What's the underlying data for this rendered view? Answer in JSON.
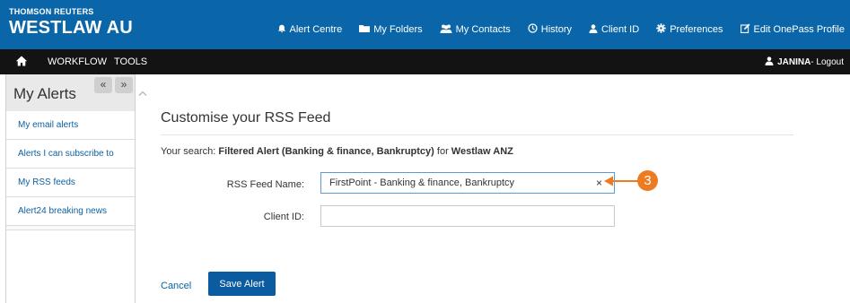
{
  "brand": {
    "company": "THOMSON REUTERS",
    "product": "WESTLAW AU"
  },
  "topnav": [
    {
      "label": "Alert Centre",
      "icon": "bell-icon"
    },
    {
      "label": "My Folders",
      "icon": "folder-icon"
    },
    {
      "label": "My Contacts",
      "icon": "contacts-icon"
    },
    {
      "label": "History",
      "icon": "clock-icon"
    },
    {
      "label": "Client ID",
      "icon": "user-icon"
    },
    {
      "label": "Preferences",
      "icon": "gear-icon"
    },
    {
      "label": "Edit OnePass Profile",
      "icon": "edit-icon"
    }
  ],
  "menubar": {
    "home_icon": "home-icon",
    "items": [
      "WORKFLOW",
      "TOOLS"
    ],
    "user_name": "JANINA",
    "logout": " - Logout"
  },
  "sidebar": {
    "title": "My Alerts",
    "collapse_left": "«",
    "collapse_right": "»",
    "items": [
      "My email alerts",
      "Alerts I can subscribe to",
      "My RSS feeds",
      "Alert24 breaking news"
    ]
  },
  "main": {
    "title": "Customise your RSS Feed",
    "search_prefix": "Your search: ",
    "search_bold": "Filtered Alert (Banking & finance, Bankruptcy)",
    "search_mid": " for ",
    "search_source": "Westlaw ANZ",
    "rss_label": "RSS Feed Name:",
    "rss_value": "FirstPoint - Banking & finance, Bankruptcy",
    "clear_symbol": "×",
    "client_label": "Client ID:",
    "client_value": "",
    "cancel_label": "Cancel",
    "save_label": "Save Alert"
  },
  "callout": {
    "number": "3",
    "color": "#ee7a22"
  },
  "colors": {
    "header_blue": "#0a66a8",
    "menubar_black": "#131313",
    "link_blue": "#0b5f9f",
    "button_blue": "#0a5ba0"
  }
}
